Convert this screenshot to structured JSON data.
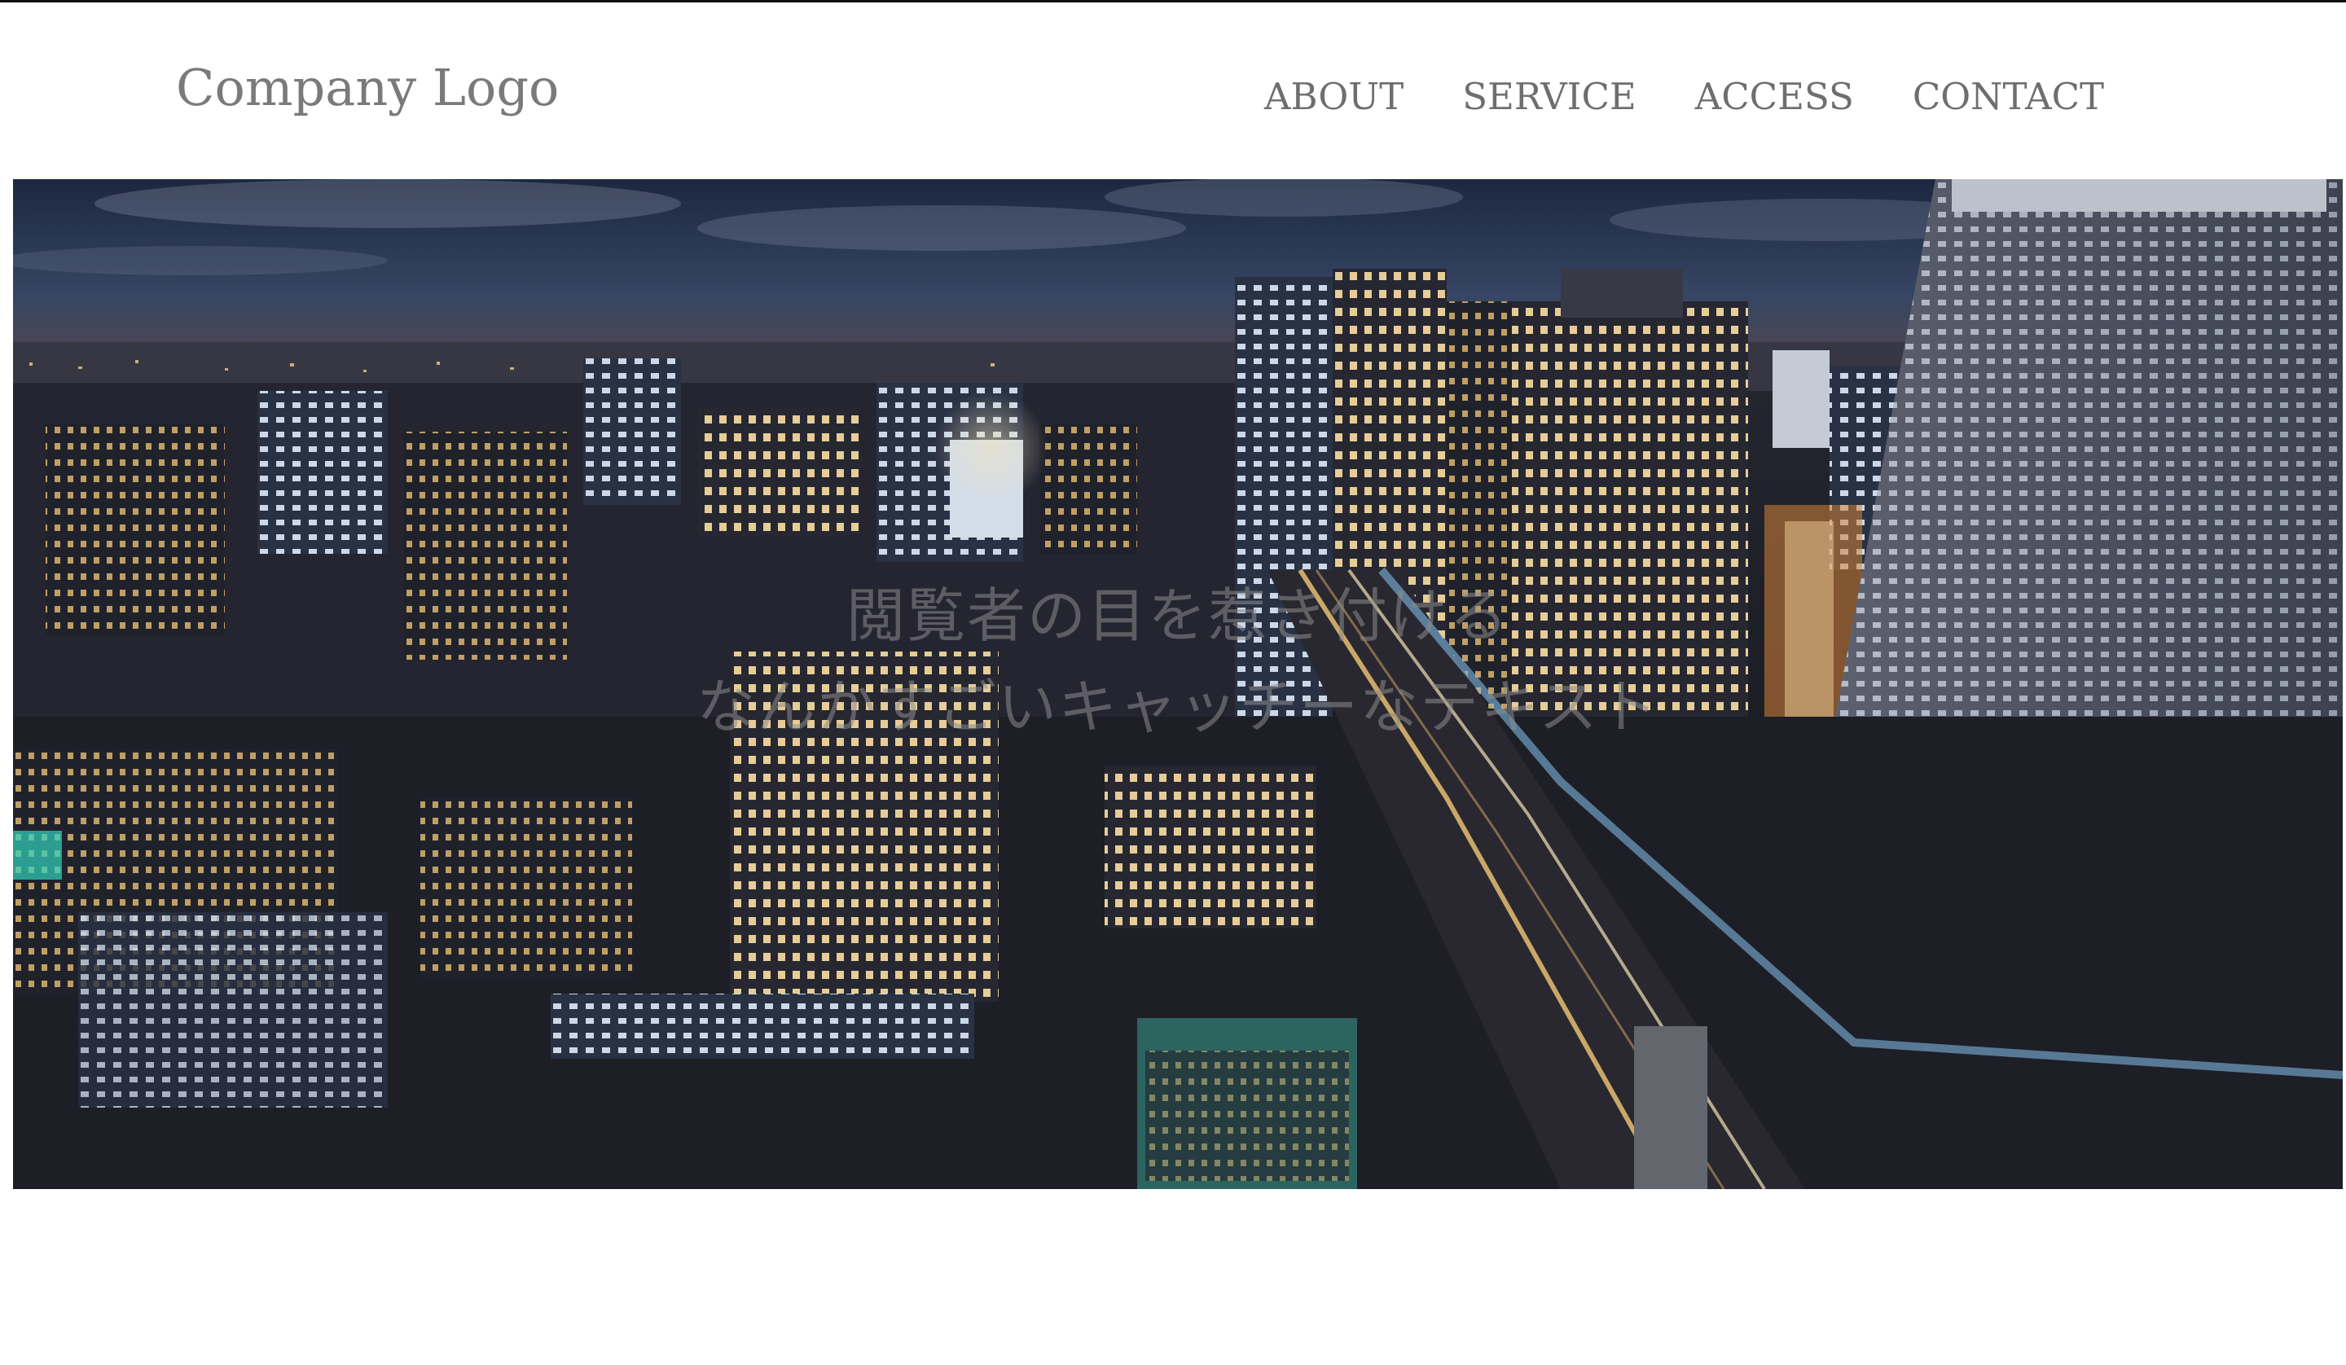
{
  "header": {
    "logo": "Company Logo",
    "nav": [
      {
        "label": "ABOUT"
      },
      {
        "label": "SERVICE"
      },
      {
        "label": "ACCESS"
      },
      {
        "label": "CONTACT"
      }
    ]
  },
  "hero": {
    "image_subject": "night city skyline",
    "catch_line_1": "閲覧者の目を惹き付ける",
    "catch_line_2": "なんかすごいキャッチーなテキスト",
    "colors": {
      "sky": "#2a3550",
      "city": "#1c1f2a",
      "lights": "#ffd98a"
    }
  }
}
